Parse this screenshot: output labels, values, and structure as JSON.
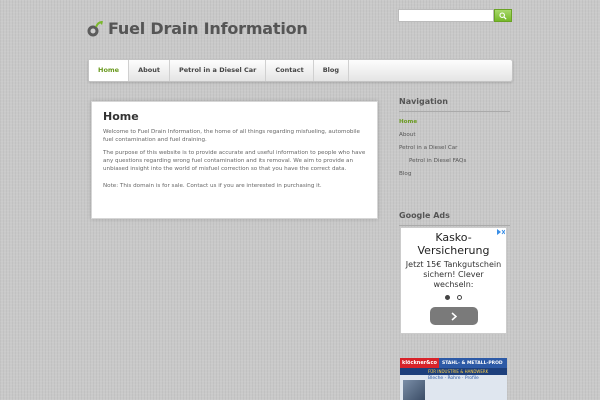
{
  "site": {
    "title": "Fuel Drain Information",
    "accent": "#6a9a1f"
  },
  "search": {
    "placeholder": "",
    "button_icon": "search-icon"
  },
  "nav": {
    "items": [
      {
        "label": "Home",
        "active": true
      },
      {
        "label": "About"
      },
      {
        "label": "Petrol in a Diesel Car"
      },
      {
        "label": "Contact"
      },
      {
        "label": "Blog"
      }
    ]
  },
  "main": {
    "heading": "Home",
    "paragraphs": [
      "Welcome to Fuel Drain Information, the home of all things regarding misfueling, automobile fuel contamination and fuel draining.",
      "The purpose of this website is to provide accurate and useful information to people who have any questions regarding wrong fuel contamination and its removal. We aim to provide an unbiased insight into the world of misfuel correction so that you have the correct data.",
      "Note: This domain is for sale. Contact us if you are interested in purchasing it."
    ]
  },
  "sidebar": {
    "navigation_title": "Navigation",
    "items": [
      {
        "label": "Home",
        "active": true
      },
      {
        "label": "About"
      },
      {
        "label": "Petrol in a Diesel Car"
      },
      {
        "label": "Petrol in Diesel FAQs",
        "sub": true
      },
      {
        "label": "Blog"
      }
    ],
    "ads_title": "Google Ads"
  },
  "ad": {
    "headline_1": "Kasko-",
    "headline_2": "Versicherung",
    "body": "Jetzt 15€ Tankgutschein sichern! Clever wechseln:",
    "next_icon": "chevron-right-icon"
  },
  "banner": {
    "brand": "klöckner&co",
    "tagline": "STAHL- & METALL-PROD",
    "subline": "FÜR INDUSTRIE & HANDWERK",
    "categories": "Bleche · Rohre · Profile"
  }
}
